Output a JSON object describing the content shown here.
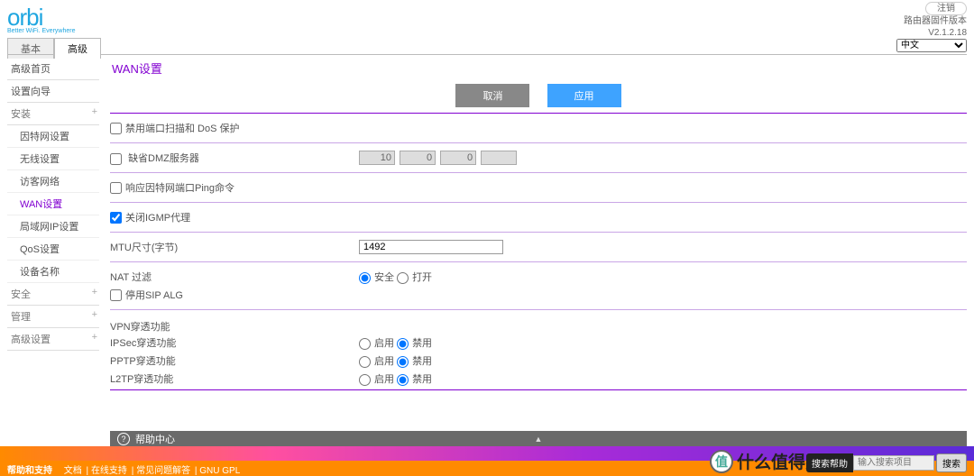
{
  "header": {
    "brand": "orbi",
    "tagline": "Better WiFi. Everywhere",
    "logout": "注销",
    "fw_label": "路由器固件版本",
    "fw_version": "V2.1.2.18",
    "language_selected": "中文"
  },
  "tabs": {
    "basic": "基本",
    "advanced": "高级"
  },
  "sidebar": {
    "home": "高级首页",
    "wizard": "设置向导",
    "install": "安装",
    "install_items": {
      "internet": "因特网设置",
      "wireless": "无线设置",
      "guest": "访客网络",
      "wan": "WAN设置",
      "lan": "局域网IP设置",
      "qos": "QoS设置",
      "devname": "设备名称"
    },
    "security": "安全",
    "management": "管理",
    "adv": "高级设置"
  },
  "page": {
    "title": "WAN设置",
    "btn_cancel": "取消",
    "btn_apply": "应用",
    "disable_portscan": "禁用端口扫描和 DoS 保护",
    "default_dmz": "缺省DMZ服务器",
    "dmz_ip": [
      "10",
      "0",
      "0",
      ""
    ],
    "respond_ping": "响应因特网端口Ping命令",
    "igmp": "关闭IGMP代理",
    "igmp_checked": true,
    "mtu_label": "MTU尺寸(字节)",
    "mtu_value": "1492",
    "nat_label": "NAT 过滤",
    "nat_safe": "安全",
    "nat_open": "打开",
    "sip_alg": "停用SIP ALG",
    "vpn_header": "VPN穿透功能",
    "vpn_ipsec": "IPSec穿透功能",
    "vpn_pptp": "PPTP穿透功能",
    "vpn_l2tp": "L2TP穿透功能",
    "opt_enable": "启用",
    "opt_disable": "禁用"
  },
  "helpbar": {
    "title": "帮助中心"
  },
  "footer": {
    "support": "帮助和支持",
    "links": [
      "文档",
      "在线支持",
      "常见问题解答",
      "GNU GPL"
    ]
  },
  "watermark": {
    "text": "什么值得买",
    "badge": "值"
  },
  "search": {
    "label": "搜索帮助",
    "placeholder": "输入搜索项目",
    "btn": "搜索"
  }
}
